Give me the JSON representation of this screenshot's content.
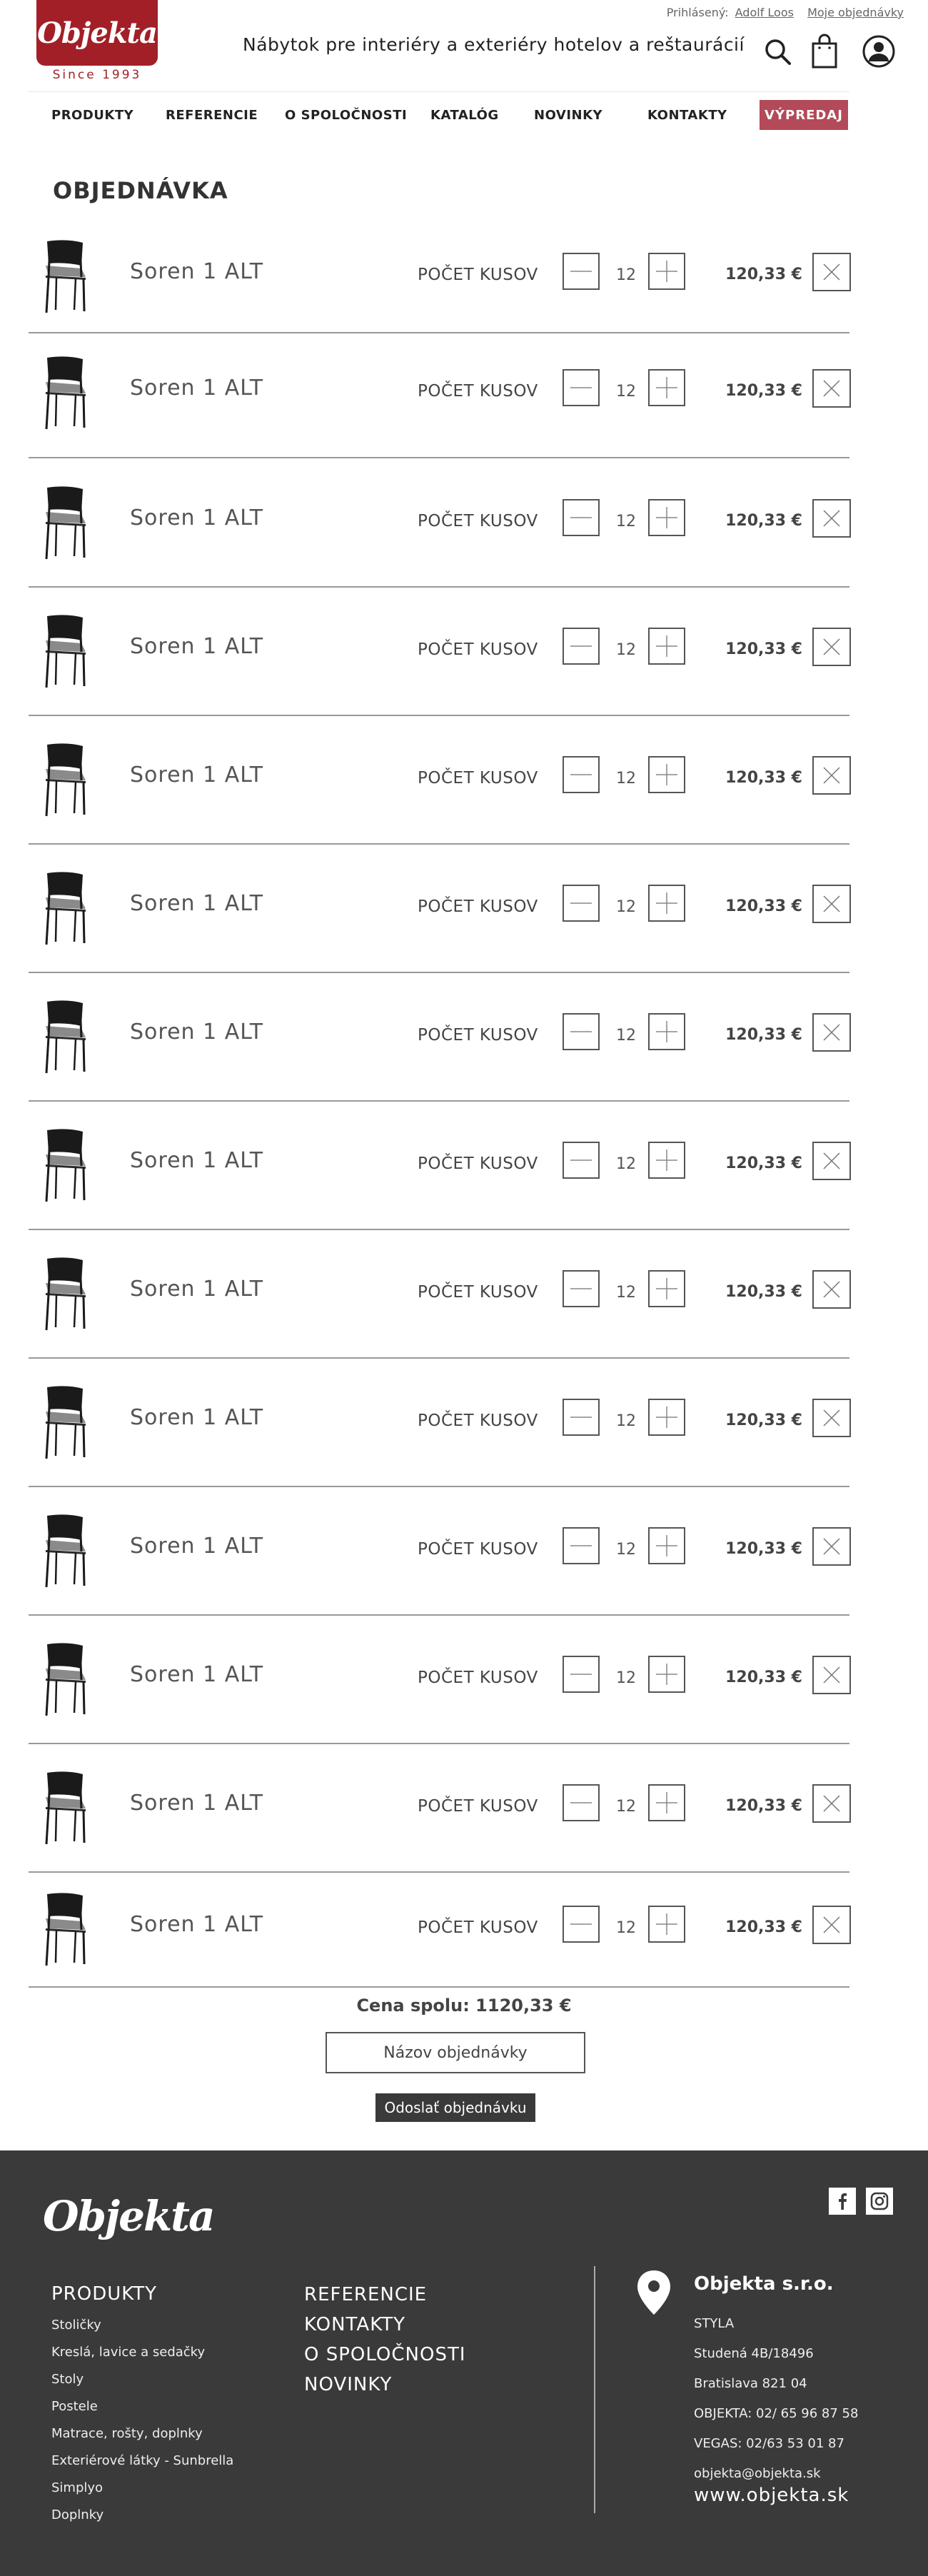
{
  "header": {
    "logo_text": "Objekta",
    "since": "Since 1993",
    "tagline": "Nábytok pre interiéry a exteriéry hotelov a reštaurácií",
    "logged_in_label": "Prihlásený:",
    "user_name": "Adolf Loos",
    "my_orders": "Moje objednávky",
    "icons": [
      "search-icon",
      "cart-icon",
      "user-icon"
    ]
  },
  "nav": {
    "items": [
      "PRODUKTY",
      "REFERENCIE",
      "O SPOLOČNOSTI",
      "KATALÓG",
      "NOVINKY",
      "KONTAKTY"
    ],
    "sale": "VÝPREDAJ",
    "sale_color": "#b34a59"
  },
  "order": {
    "title": "OBJEDNÁVKA",
    "qty_label": "POČET KUSOV",
    "items": [
      {
        "name": "Soren 1 ALT",
        "quantity": "12",
        "price": "120,33 €"
      },
      {
        "name": "Soren 1 ALT",
        "quantity": "12",
        "price": "120,33 €"
      },
      {
        "name": "Soren 1 ALT",
        "quantity": "12",
        "price": "120,33 €"
      },
      {
        "name": "Soren 1 ALT",
        "quantity": "12",
        "price": "120,33 €"
      },
      {
        "name": "Soren 1 ALT",
        "quantity": "12",
        "price": "120,33 €"
      },
      {
        "name": "Soren 1 ALT",
        "quantity": "12",
        "price": "120,33 €"
      },
      {
        "name": "Soren 1 ALT",
        "quantity": "12",
        "price": "120,33 €"
      },
      {
        "name": "Soren 1 ALT",
        "quantity": "12",
        "price": "120,33 €"
      },
      {
        "name": "Soren 1 ALT",
        "quantity": "12",
        "price": "120,33 €"
      },
      {
        "name": "Soren 1 ALT",
        "quantity": "12",
        "price": "120,33 €"
      },
      {
        "name": "Soren 1 ALT",
        "quantity": "12",
        "price": "120,33 €"
      },
      {
        "name": "Soren 1 ALT",
        "quantity": "12",
        "price": "120,33 €"
      },
      {
        "name": "Soren 1 ALT",
        "quantity": "12",
        "price": "120,33 €"
      },
      {
        "name": "Soren 1 ALT",
        "quantity": "12",
        "price": "120,33 €"
      }
    ],
    "total": "Cena spolu: 1120,33 €",
    "order_name_placeholder": "Názov objednávky",
    "submit": "Odoslať objednávku"
  },
  "footer": {
    "logo_text": "Objekta",
    "social": [
      "facebook-icon",
      "instagram-icon"
    ],
    "products_title": "PRODUKTY",
    "products": [
      "Stoličky",
      "Kreslá, lavice a sedačky",
      "Stoly",
      "Postele",
      "Matrace, rošty, doplnky",
      "Exteriérové látky - Sunbrella",
      "Simplyo",
      "Doplnky"
    ],
    "links": [
      "REFERENCIE",
      "KONTAKTY",
      "O SPOLOČNOSTI",
      "NOVINKY"
    ],
    "company": "Objekta s.r.o.",
    "contact": [
      "STYLA",
      "Studená 4B/18496",
      "Bratislava 821 04",
      "OBJEKTA: 02/ 65 96 87 58",
      "VEGAS: 02/63 53 01 87",
      "objekta@objekta.sk"
    ],
    "website": "www.objekta.sk",
    "background": "#3a3a3a"
  },
  "colors": {
    "brand": "#a31f27",
    "accent": "#b34a59"
  }
}
